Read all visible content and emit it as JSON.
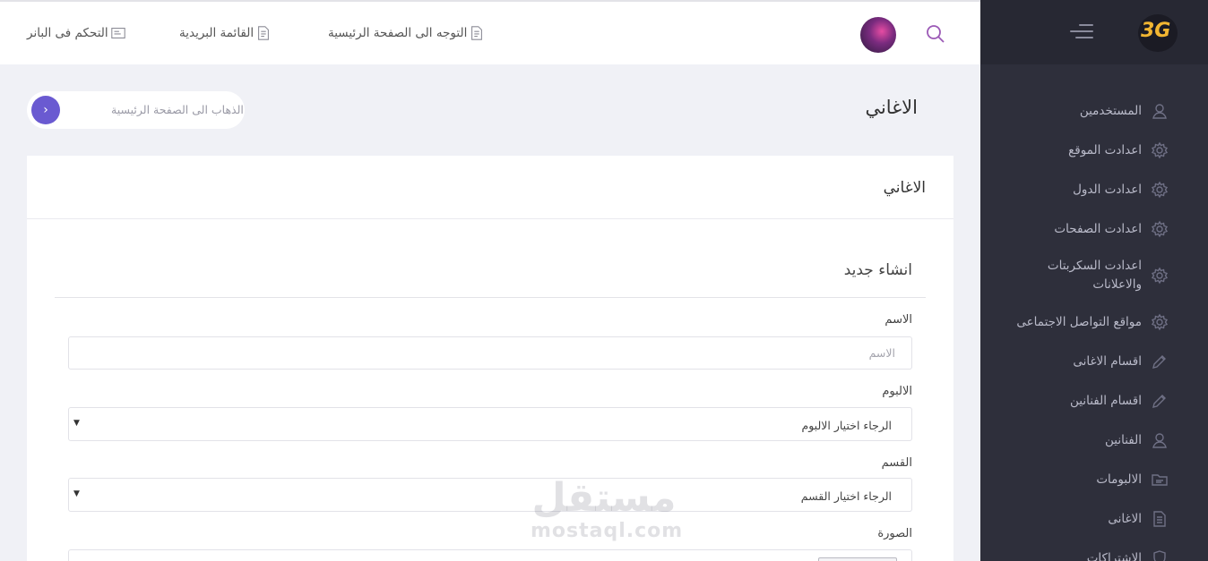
{
  "header": {
    "nav_links": [
      {
        "label": "التوجه الى الصفحة الرئيسية",
        "icon": "document-icon"
      },
      {
        "label": "القائمة البريدية",
        "icon": "document-icon"
      },
      {
        "label": "التحكم فى البانر",
        "icon": "folder-icon"
      }
    ],
    "search_icon": "search-icon",
    "avatar": "user-avatar"
  },
  "sidebar": {
    "logo_text": "3G",
    "items": [
      {
        "label": "المستخدمين",
        "icon": "user-icon"
      },
      {
        "label": "اعدادت الموقع",
        "icon": "gear-icon"
      },
      {
        "label": "اعدادت الدول",
        "icon": "gear-icon"
      },
      {
        "label": "اعدادت الصفحات",
        "icon": "gear-icon"
      },
      {
        "label": "اعدادت السكربتات والاعلانات",
        "icon": "gear-icon"
      },
      {
        "label": "مواقع التواصل الاجتماعى",
        "icon": "gear-icon"
      },
      {
        "label": "اقسام الاغانى",
        "icon": "pencil-icon"
      },
      {
        "label": "اقسام الفنانين",
        "icon": "pencil-icon"
      },
      {
        "label": "الفنانين",
        "icon": "user-icon"
      },
      {
        "label": "الالبومات",
        "icon": "folder-icon"
      },
      {
        "label": "الاغانى",
        "icon": "document-icon"
      },
      {
        "label": "الاشتراكات",
        "icon": "shield-icon"
      }
    ]
  },
  "page": {
    "title": "الاغاني",
    "breadcrumb": "الذهاب الى الصفحة الرئيسية",
    "breadcrumb_icon": "chevron-right-icon"
  },
  "card": {
    "title": "الاغاني",
    "section_title": "انشاء جديد",
    "fields": {
      "name": {
        "label": "الاسم",
        "placeholder": "الاسم"
      },
      "album": {
        "label": "الالبوم",
        "value": "الرجاء اختيار الالبوم"
      },
      "category": {
        "label": "القسم",
        "value": "الرجاء اختيار القسم"
      },
      "image": {
        "label": "الصورة"
      }
    }
  },
  "watermark": {
    "arabic": "مستقل",
    "english": "mostaql.com"
  },
  "colors": {
    "sidebar_bg": "#2e2f3b",
    "accent": "#6a5ad1",
    "search": "#9b59b6"
  }
}
